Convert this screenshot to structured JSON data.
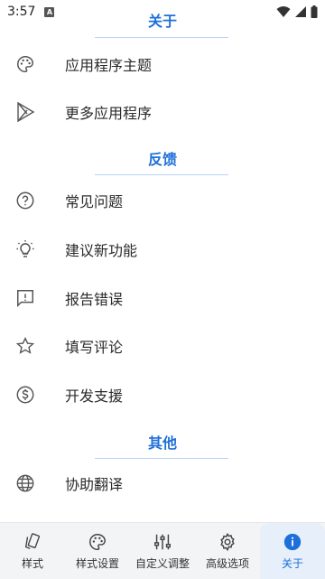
{
  "status_bar": {
    "time": "3:57",
    "notification_badge": "A"
  },
  "sections": [
    {
      "title": "关于",
      "items": [
        {
          "label": "应用程序主题",
          "icon": "palette-icon"
        },
        {
          "label": "更多应用程序",
          "icon": "play-store-icon"
        }
      ]
    },
    {
      "title": "反馈",
      "items": [
        {
          "label": "常见问题",
          "icon": "help-circle-icon"
        },
        {
          "label": "建议新功能",
          "icon": "lightbulb-icon"
        },
        {
          "label": "报告错误",
          "icon": "report-icon"
        },
        {
          "label": "填写评论",
          "icon": "star-icon"
        },
        {
          "label": "开发支援",
          "icon": "dollar-icon"
        }
      ]
    },
    {
      "title": "其他",
      "items": [
        {
          "label": "协助翻译",
          "icon": "globe-icon"
        }
      ]
    }
  ],
  "bottom_nav": [
    {
      "label": "样式",
      "icon": "style-icon",
      "active": false
    },
    {
      "label": "样式设置",
      "icon": "palette-icon",
      "active": false
    },
    {
      "label": "自定义调整",
      "icon": "sliders-icon",
      "active": false
    },
    {
      "label": "高级选项",
      "icon": "gear-icon",
      "active": false
    },
    {
      "label": "关于",
      "icon": "info-icon",
      "active": true
    }
  ],
  "colors": {
    "accent": "#1e6fd9",
    "divider": "#b9d3f3",
    "nav_bg": "#f3f4f6"
  }
}
